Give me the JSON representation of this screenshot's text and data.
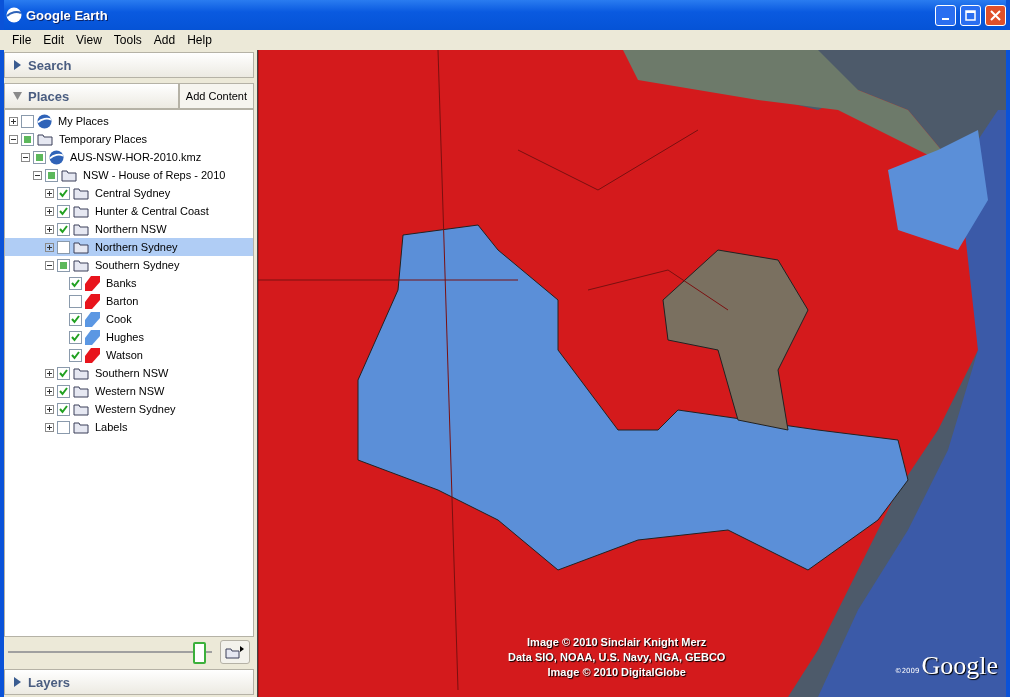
{
  "window": {
    "title": "Google Earth"
  },
  "menu": [
    "File",
    "Edit",
    "View",
    "Tools",
    "Add",
    "Help"
  ],
  "search_panel": {
    "label": "Search",
    "expanded": false
  },
  "places_panel": {
    "label": "Places",
    "expanded": true,
    "add_button": "Add Content"
  },
  "tree": [
    {
      "label": "My Places",
      "kind": "globe",
      "checked": false,
      "expanded": false,
      "selected": false
    },
    {
      "label": "Temporary Places",
      "kind": "folder",
      "checked": false,
      "partial": true,
      "expanded": true,
      "selected": false,
      "children": [
        {
          "label": "AUS-NSW-HOR-2010.kmz",
          "kind": "globe",
          "checked": false,
          "partial": true,
          "expanded": true,
          "selected": false,
          "children": [
            {
              "label": "NSW - House of Reps - 2010",
              "kind": "folder",
              "checked": false,
              "partial": true,
              "expanded": true,
              "selected": false,
              "children": [
                {
                  "label": "Central Sydney",
                  "kind": "folder",
                  "checked": true,
                  "expanded": false,
                  "selected": false
                },
                {
                  "label": "Hunter & Central Coast",
                  "kind": "folder",
                  "checked": true,
                  "expanded": false,
                  "selected": false
                },
                {
                  "label": "Northern NSW",
                  "kind": "folder",
                  "checked": true,
                  "expanded": false,
                  "selected": false
                },
                {
                  "label": "Northern Sydney",
                  "kind": "folder",
                  "checked": false,
                  "expanded": false,
                  "selected": true
                },
                {
                  "label": "Southern Sydney",
                  "kind": "folder",
                  "checked": false,
                  "partial": true,
                  "expanded": true,
                  "selected": false,
                  "children": [
                    {
                      "label": "Banks",
                      "kind": "polygon",
                      "color": "#e8141c",
                      "checked": true,
                      "selected": false
                    },
                    {
                      "label": "Barton",
                      "kind": "polygon",
                      "color": "#e8141c",
                      "checked": false,
                      "selected": false
                    },
                    {
                      "label": "Cook",
                      "kind": "polygon",
                      "color": "#5b97e3",
                      "checked": true,
                      "selected": false
                    },
                    {
                      "label": "Hughes",
                      "kind": "polygon",
                      "color": "#5b97e3",
                      "checked": true,
                      "selected": false
                    },
                    {
                      "label": "Watson",
                      "kind": "polygon",
                      "color": "#e8141c",
                      "checked": true,
                      "selected": false
                    }
                  ]
                },
                {
                  "label": "Southern NSW",
                  "kind": "folder",
                  "checked": true,
                  "expanded": false,
                  "selected": false
                },
                {
                  "label": "Western NSW",
                  "kind": "folder",
                  "checked": true,
                  "expanded": false,
                  "selected": false
                },
                {
                  "label": "Western Sydney",
                  "kind": "folder",
                  "checked": true,
                  "expanded": false,
                  "selected": false
                },
                {
                  "label": "Labels",
                  "kind": "folder",
                  "checked": false,
                  "expanded": false,
                  "selected": false
                }
              ]
            }
          ]
        }
      ]
    }
  ],
  "opacity_slider": {
    "level": 0.97
  },
  "layers_panel": {
    "label": "Layers",
    "expanded": false
  },
  "map": {
    "attribution": [
      "Image © 2010 Sinclair Knight Merz",
      "Data SIO, NOAA, U.S. Navy, NGA, GEBCO",
      "Image © 2010 DigitalGlobe"
    ],
    "logo_year": "©2009",
    "logo": "Google"
  }
}
